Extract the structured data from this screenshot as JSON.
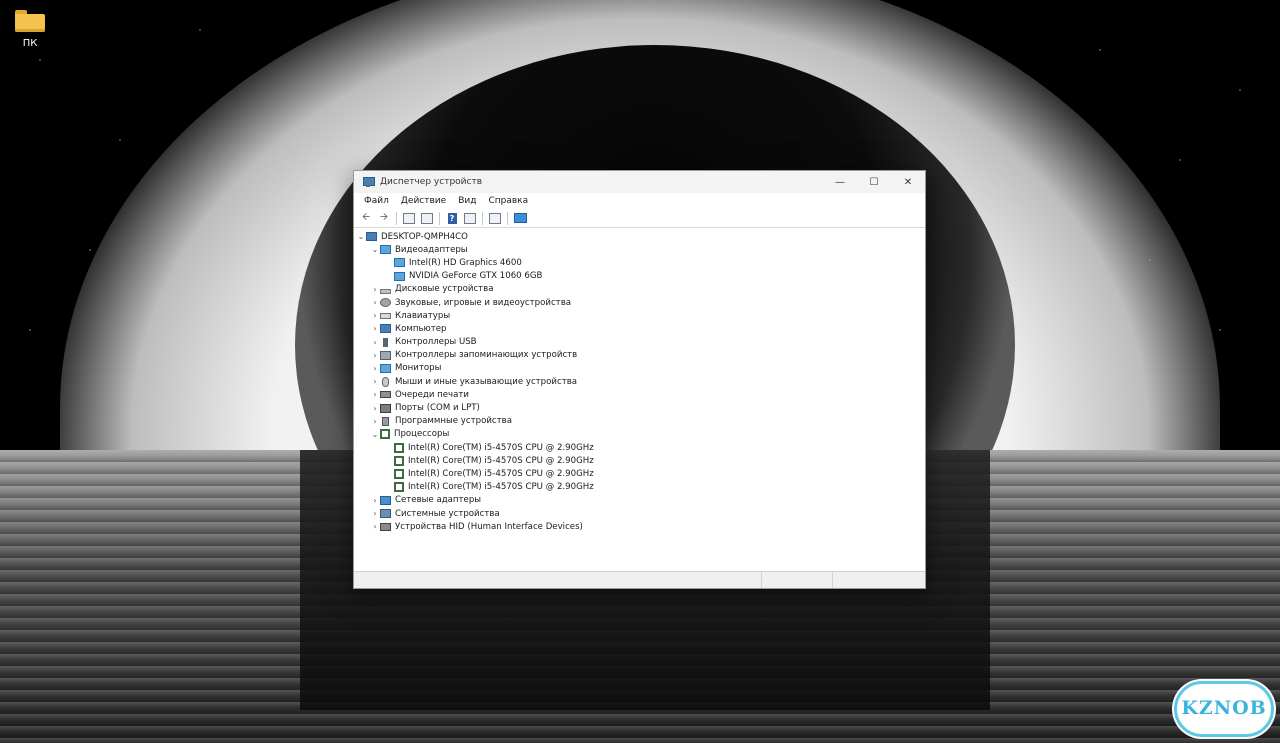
{
  "desktop": {
    "icon_label": "ПК"
  },
  "window": {
    "title": "Диспетчер устройств",
    "controls": {
      "minimize": "—",
      "maximize": "☐",
      "close": "✕"
    },
    "menu": [
      "Файл",
      "Действие",
      "Вид",
      "Справка"
    ],
    "toolbar_icons": [
      "back-arrow-icon",
      "forward-arrow-icon",
      "properties-icon",
      "tree-view-icon",
      "help-icon",
      "panel-icon",
      "scan-hardware-icon",
      "monitor-icon"
    ],
    "tree": {
      "root": "DESKTOP-QMPH4CO",
      "items": [
        {
          "label": "Видеоадаптеры",
          "expanded": true,
          "icon": "display-adapter-icon",
          "children": [
            "Intel(R) HD Graphics 4600",
            "NVIDIA GeForce GTX 1060 6GB"
          ]
        },
        {
          "label": "Дисковые устройства",
          "icon": "disk-icon"
        },
        {
          "label": "Звуковые, игровые и видеоустройства",
          "icon": "sound-icon"
        },
        {
          "label": "Клавиатуры",
          "icon": "keyboard-icon"
        },
        {
          "label": "Компьютер",
          "icon": "computer-icon"
        },
        {
          "label": "Контроллеры USB",
          "icon": "usb-icon"
        },
        {
          "label": "Контроллеры запоминающих устройств",
          "icon": "storage-controller-icon"
        },
        {
          "label": "Мониторы",
          "icon": "monitor-icon"
        },
        {
          "label": "Мыши и иные указывающие устройства",
          "icon": "mouse-icon"
        },
        {
          "label": "Очереди печати",
          "icon": "printer-icon"
        },
        {
          "label": "Порты (COM и LPT)",
          "icon": "port-icon"
        },
        {
          "label": "Программные устройства",
          "icon": "software-device-icon"
        },
        {
          "label": "Процессоры",
          "expanded": true,
          "icon": "processor-icon",
          "children": [
            "Intel(R) Core(TM) i5-4570S CPU @ 2.90GHz",
            "Intel(R) Core(TM) i5-4570S CPU @ 2.90GHz",
            "Intel(R) Core(TM) i5-4570S CPU @ 2.90GHz",
            "Intel(R) Core(TM) i5-4570S CPU @ 2.90GHz"
          ]
        },
        {
          "label": "Сетевые адаптеры",
          "icon": "network-adapter-icon"
        },
        {
          "label": "Системные устройства",
          "icon": "system-device-icon"
        },
        {
          "label": "Устройства HID (Human Interface Devices)",
          "icon": "hid-icon"
        }
      ]
    }
  },
  "watermark": {
    "text": "KZNOB"
  },
  "colors": {
    "accent": "#2b6ea6",
    "watermark": "#39b4dc",
    "cpu_icon": "#3f6b3f"
  }
}
